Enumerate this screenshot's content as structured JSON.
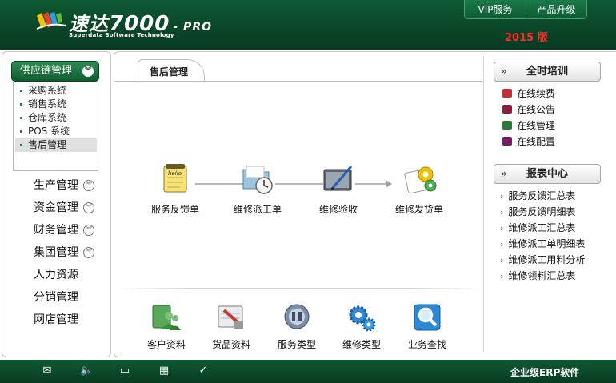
{
  "header": {
    "brand": "速达",
    "brand_num": "7000",
    "brand_suffix": "- PRO",
    "subtitle": "Superdata Software Technology",
    "links": [
      "VIP服务",
      "产品升级"
    ],
    "year": "2015 版"
  },
  "sidebar": {
    "group": "供应链管理",
    "subitems": [
      "采购系统",
      "销售系统",
      "仓库系统",
      "POS 系统",
      "售后管理"
    ],
    "active_subitem": "售后管理",
    "items": [
      {
        "label": "生产管理",
        "expandable": true
      },
      {
        "label": "资金管理",
        "expandable": true
      },
      {
        "label": "财务管理",
        "expandable": true
      },
      {
        "label": "集团管理",
        "expandable": true
      },
      {
        "label": "人力资源",
        "expandable": false
      },
      {
        "label": "分销管理",
        "expandable": false
      },
      {
        "label": "网店管理",
        "expandable": false
      }
    ]
  },
  "main": {
    "tab": "售后管理",
    "flow": [
      {
        "label": "服务反馈单",
        "icon": "notepad-icon"
      },
      {
        "label": "维修派工单",
        "icon": "folder-clock-icon"
      },
      {
        "label": "维修验收",
        "icon": "pen-tablet-icon"
      },
      {
        "label": "维修发货单",
        "icon": "gear-document-icon"
      }
    ],
    "tools": [
      {
        "label": "客户资料",
        "icon": "customers-icon"
      },
      {
        "label": "货品资料",
        "icon": "goods-icon"
      },
      {
        "label": "服务类型",
        "icon": "service-icon"
      },
      {
        "label": "维修类型",
        "icon": "gears-icon"
      },
      {
        "label": "业务查找",
        "icon": "magnifier-icon"
      }
    ]
  },
  "right": {
    "training_title": "全时培训",
    "training_items": [
      "在线续费",
      "在线公告",
      "在线管理",
      "在线配置"
    ],
    "training_colors": [
      "#c0303a",
      "#8a2040",
      "#2a7a3a",
      "#702060"
    ],
    "report_title": "报表中心",
    "report_items": [
      "服务反馈汇总表",
      "服务反馈明细表",
      "维修派工汇总表",
      "维修派工单明细表",
      "维修派工用料分析",
      "维修领料汇总表"
    ]
  },
  "footer": {
    "icons": [
      "mail-icon",
      "speaker-icon",
      "book-icon",
      "calculator-icon",
      "check-icon"
    ],
    "text": "企业级ERP软件"
  }
}
